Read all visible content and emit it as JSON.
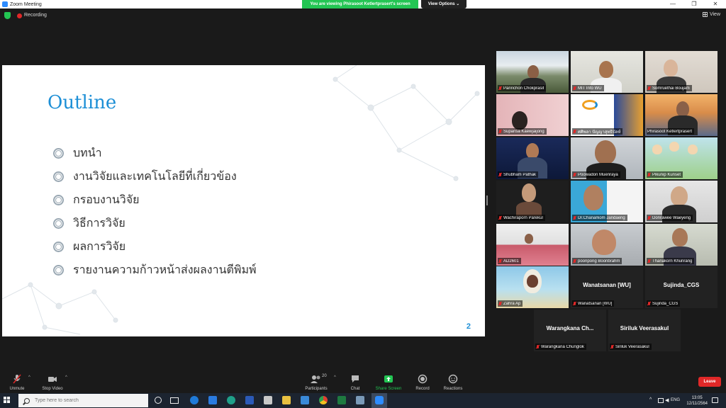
{
  "window": {
    "title": "Zoom Meeting",
    "min": "—",
    "max": "❐",
    "close": "✕"
  },
  "banner": {
    "viewing": "You are viewing Phirasoot Ketlertprasert's screen",
    "view_options": "View Options ⌄"
  },
  "topbar": {
    "recording": "Recording",
    "view": "View"
  },
  "slide": {
    "title": "Outline",
    "bullets": [
      "บทนำ",
      "งานวิจัยและเทคโนโลยีที่เกี่ยวข้อง",
      "กรอบงานวิจัย",
      "วิธีการวิจัย",
      "ผลการวิจัย",
      "รายงานความก้าวหน้าส่งผลงานตีพิมพ์"
    ],
    "page": "2"
  },
  "participants": [
    {
      "name": "Panrichon Chokprasit"
    },
    {
      "name": "MIT Info WU"
    },
    {
      "name": "Somruethai Boujam"
    },
    {
      "name": "Supansa Kaewjaijong"
    },
    {
      "name": "ศศิพลา ปัญญาสุทธิบัลห์"
    },
    {
      "name": "Phirasoot Ketlertprasert"
    },
    {
      "name": "Shubham Pathak"
    },
    {
      "name": "Poowadon Muenraya"
    },
    {
      "name": "Pikunip Kunset"
    },
    {
      "name": "Wachiraporn Parekul"
    },
    {
      "name": "Dr.Chanarkom Jandaeng"
    },
    {
      "name": "Donrawee Waeyeng"
    },
    {
      "name": "AD2601"
    },
    {
      "name": "poonpong Boonbrahm"
    },
    {
      "name": "Thanakorn Khunrang"
    },
    {
      "name": "Zahra Ap"
    },
    {
      "name": "Wanatsanan [WU]",
      "center": "Wanatsanan [WU]"
    },
    {
      "name": "Sujinda_CGS",
      "center": "Sujinda_CGS"
    },
    {
      "name": "Warangkana Chunglok",
      "center": "Warangkana  Ch..."
    },
    {
      "name": "Siriluk Veerasakul",
      "center": "Siriluk Veerasakul"
    }
  ],
  "toolbar": {
    "unmute": "Unmute",
    "stop_video": "Stop Video",
    "participants": "Participants",
    "participants_count": "20",
    "chat": "Chat",
    "share_screen": "Share Screen",
    "record": "Record",
    "reactions": "Reactions",
    "leave": "Leave",
    "caret": "^"
  },
  "taskbar": {
    "search_placeholder": "Type here to search",
    "language": "ENG",
    "time": "13:05",
    "date": "12/11/2564"
  },
  "colors": {
    "zoom_blue": "#2d8cff",
    "share_green": "#23c553",
    "leave_red": "#e02828",
    "speaker_yellow": "#f5d90a",
    "slide_title": "#1d8fd6"
  }
}
